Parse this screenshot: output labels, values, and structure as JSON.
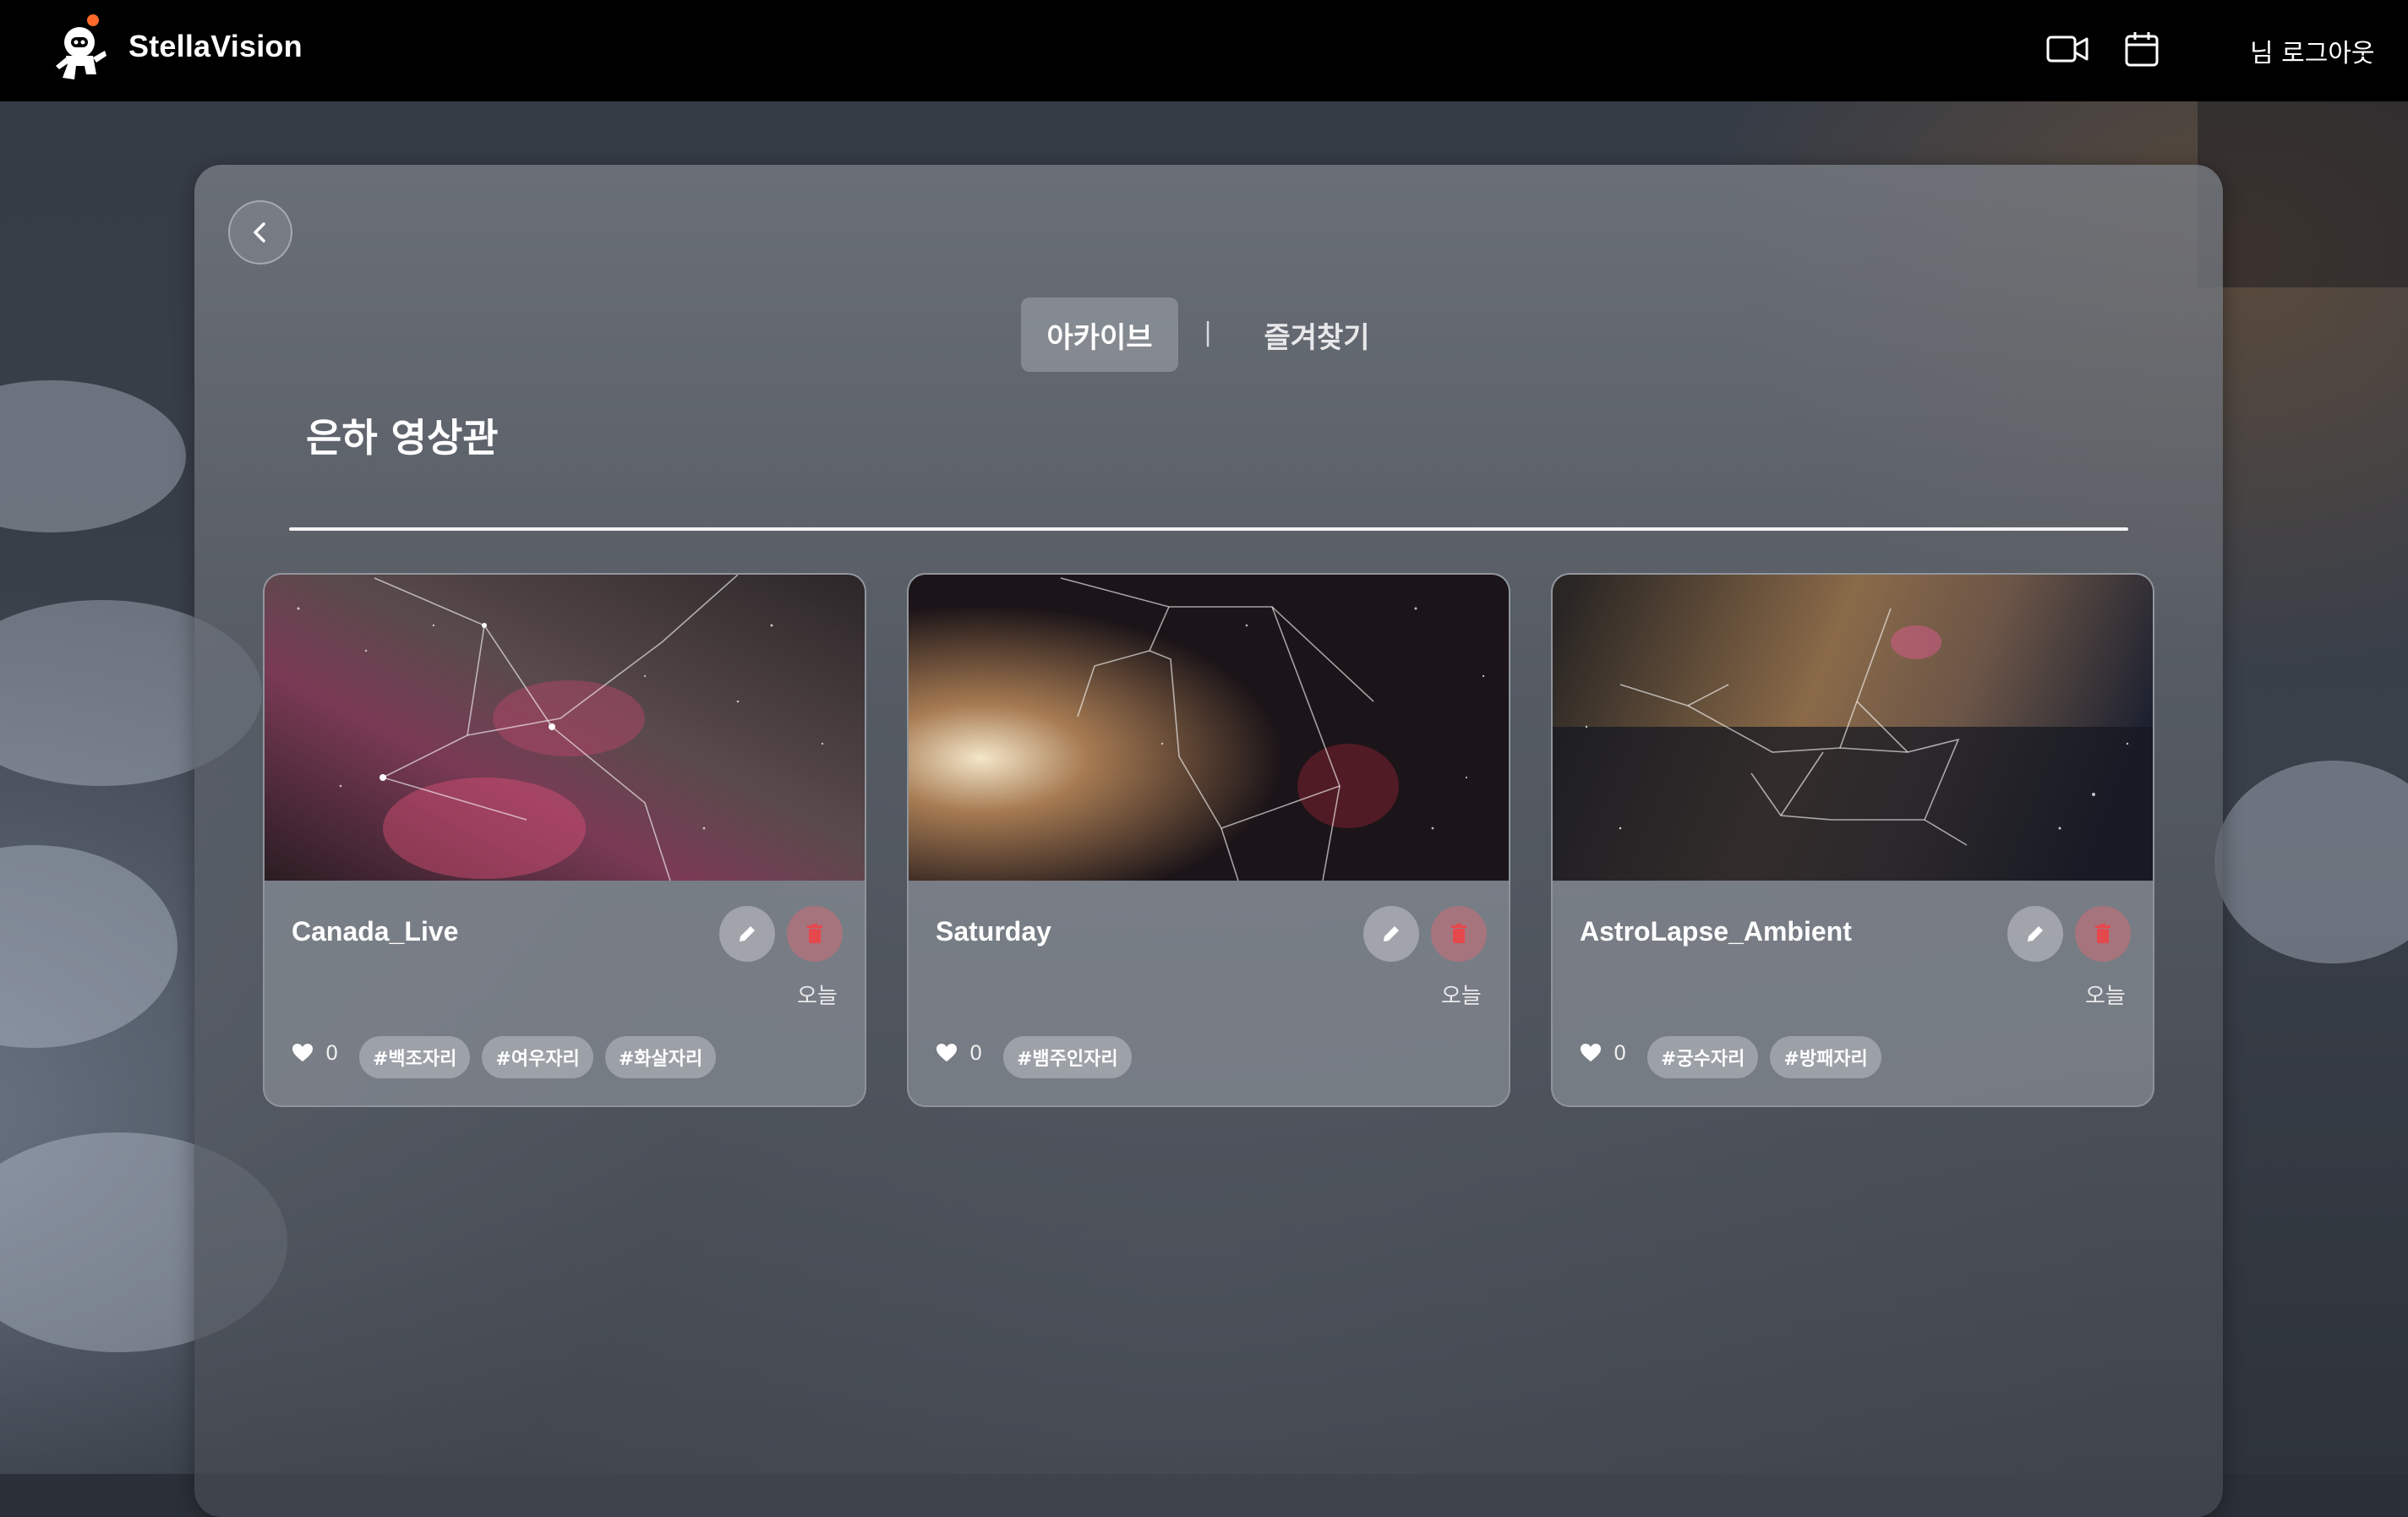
{
  "app": {
    "brand": "StellaVision"
  },
  "header": {
    "logout_label": "님 로그아웃"
  },
  "tabs": [
    {
      "label": "아카이브",
      "active": true
    },
    {
      "label": "즐겨찾기",
      "active": false
    }
  ],
  "tab_separator": "|",
  "section_title": "은하 영상관",
  "cards": [
    {
      "title": "Canada_Live",
      "date": "오늘",
      "likes": "0",
      "tags": [
        "#백조자리",
        "#여우자리",
        "#화살자리"
      ]
    },
    {
      "title": "Saturday",
      "date": "오늘",
      "likes": "0",
      "tags": [
        "#뱀주인자리"
      ]
    },
    {
      "title": "AstroLapse_Ambient",
      "date": "오늘",
      "likes": "0",
      "tags": [
        "#궁수자리",
        "#방패자리"
      ]
    }
  ],
  "icons": {
    "logo": "astronaut-logo-icon",
    "video": "video-camera-icon",
    "calendar": "calendar-icon",
    "back": "chevron-left-icon",
    "edit": "pencil-icon",
    "delete": "trash-icon",
    "like": "heart-icon"
  },
  "colors": {
    "topbar": "#000000",
    "delete_accent": "#e5484d",
    "logo_accent": "#ff6a2a"
  }
}
